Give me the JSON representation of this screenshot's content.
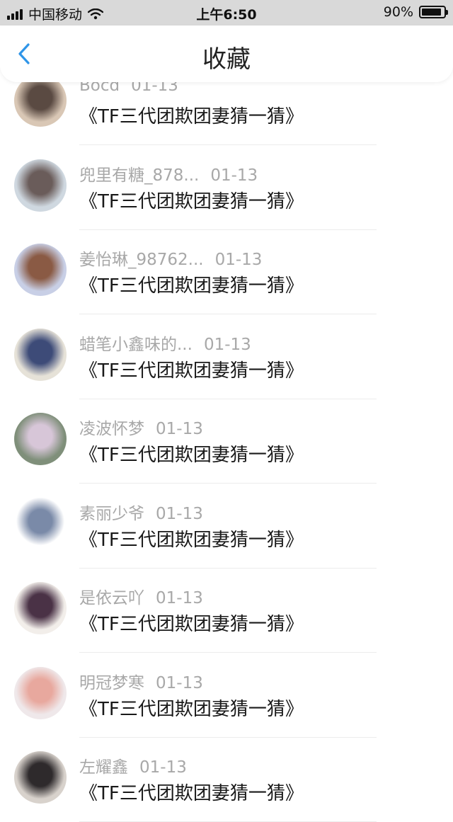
{
  "status": {
    "carrier": "中国移动",
    "time": "上午6:50",
    "battery_text": "90%",
    "battery_level": 0.9
  },
  "header": {
    "title": "收藏",
    "back_icon": "chevron-left-icon"
  },
  "colors": {
    "accent": "#2f95e8",
    "meta_text": "#a8a8a8"
  },
  "items": [
    {
      "user": "Bocd",
      "date": "01-13",
      "title": "《TF三代团欺团妻猜一猜》",
      "avatar_colors": [
        "#d9c7b5",
        "#5a4a42"
      ]
    },
    {
      "user": "兜里有糖_878...",
      "date": "01-13",
      "title": "《TF三代团欺团妻猜一猜》",
      "avatar_colors": [
        "#cfd8e0",
        "#6a5c5a"
      ]
    },
    {
      "user": "姜怡琳_98762...",
      "date": "01-13",
      "title": "《TF三代团欺团妻猜一猜》",
      "avatar_colors": [
        "#c8cfe6",
        "#8a5a44"
      ]
    },
    {
      "user": "蜡笔小鑫味的...",
      "date": "01-13",
      "title": "《TF三代团欺团妻猜一猜》",
      "avatar_colors": [
        "#e6e2d8",
        "#3d4b78"
      ]
    },
    {
      "user": "凌波怀梦",
      "date": "01-13",
      "title": "《TF三代团欺团妻猜一猜》",
      "avatar_colors": [
        "#7f8f7a",
        "#d7c6d8"
      ]
    },
    {
      "user": "素丽少爷",
      "date": "01-13",
      "title": "《TF三代团欺团妻猜一猜》",
      "avatar_colors": [
        "#ffffff",
        "#7a8aa8"
      ]
    },
    {
      "user": "是依云吖",
      "date": "01-13",
      "title": "《TF三代团欺团妻猜一猜》",
      "avatar_colors": [
        "#f2eeea",
        "#4a3246"
      ]
    },
    {
      "user": "明冠梦寒",
      "date": "01-13",
      "title": "《TF三代团欺团妻猜一猜》",
      "avatar_colors": [
        "#efe8ea",
        "#e8a89e"
      ]
    },
    {
      "user": "左耀鑫",
      "date": "01-13",
      "title": "《TF三代团欺团妻猜一猜》",
      "avatar_colors": [
        "#d8d2cc",
        "#2e2a2c"
      ]
    }
  ]
}
